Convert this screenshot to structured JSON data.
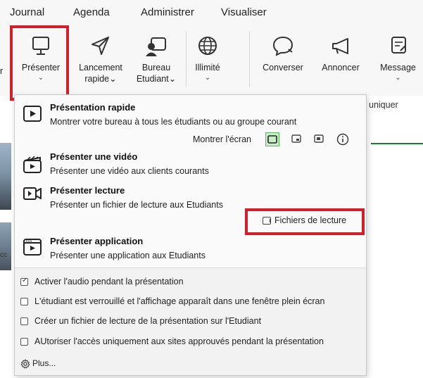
{
  "menu": [
    "Journal",
    "Agenda",
    "Administrer",
    "Visualiser"
  ],
  "ribbon": {
    "buttons": [
      {
        "label": "Présenter",
        "label2": "",
        "chevron": "⌄",
        "icon": "presenter-icon"
      },
      {
        "label": "Lancement",
        "label2": "rapide⌄",
        "chevron": "",
        "icon": "send-icon"
      },
      {
        "label": "Bureau",
        "label2": "Etudiant⌄",
        "chevron": "",
        "icon": "student-desktop-icon"
      },
      {
        "label": "Illimité",
        "label2": "",
        "chevron": "⌄",
        "icon": "globe-icon"
      },
      {
        "label": "Converser",
        "label2": "",
        "chevron": "",
        "icon": "chat-icon"
      },
      {
        "label": "Annoncer",
        "label2": "",
        "chevron": "",
        "icon": "megaphone-icon"
      },
      {
        "label": "Message",
        "label2": "",
        "chevron": "⌄",
        "icon": "message-icon"
      }
    ],
    "group_label": "uniquer",
    "left_edge_label": "r",
    "left_thumb_text": "cc"
  },
  "dropdown": {
    "options": [
      {
        "title": "Présentation rapide",
        "desc": "Montrer votre bureau à tous les étudiants ou au groupe courant",
        "icon": "play-screen-icon"
      },
      {
        "title": "Présenter une vidéo",
        "desc": "Présenter une vidéo aux clients courants",
        "icon": "video-clapper-icon"
      },
      {
        "title": "Présenter lecture",
        "desc": "Présenter un fichier de lecture aux Etudiants",
        "icon": "video-camera-icon"
      },
      {
        "title": "Présenter application",
        "desc": "Présenter une application aux Etudiants",
        "icon": "app-window-icon"
      }
    ],
    "show_screen_label": "Montrer l'écran",
    "files_button": "Fichiers de lecture",
    "checkboxes": [
      {
        "label": "Activer l'audio pendant la présentation",
        "checked": true
      },
      {
        "label": "L'étudiant est verrouillé et l'affichage apparaît dans une fenêtre plein écran",
        "checked": false
      },
      {
        "label": "Créer un fichier de lecture de la présentation sur l'Etudiant",
        "checked": false
      },
      {
        "label": "AUtoriser l'accès uniquement aux sites approuvés pendant la présentation",
        "checked": false
      }
    ],
    "more": "Plus..."
  },
  "colors": {
    "highlight": "#d21f2c",
    "active_screen": "#c9ecc9",
    "accent_line": "#1f7a3a"
  }
}
